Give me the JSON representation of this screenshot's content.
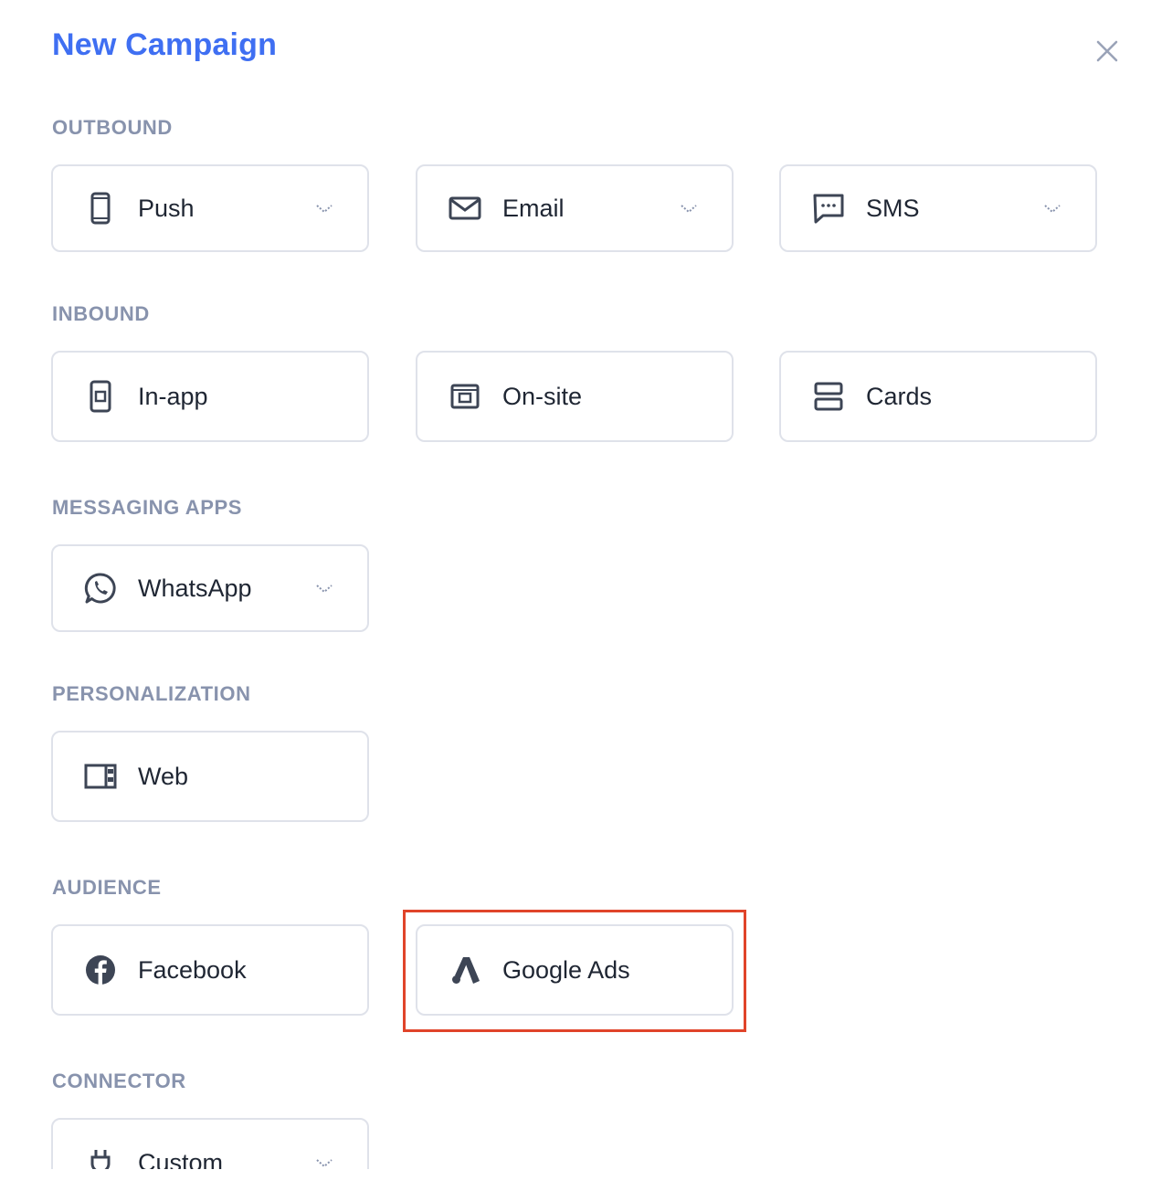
{
  "header": {
    "title": "New Campaign"
  },
  "sections": {
    "outbound": {
      "label": "OUTBOUND",
      "items": [
        {
          "label": "Push",
          "icon": "phone-icon"
        },
        {
          "label": "Email",
          "icon": "envelope-icon"
        },
        {
          "label": "SMS",
          "icon": "chat-bubble-icon"
        }
      ]
    },
    "inbound": {
      "label": "INBOUND",
      "items": [
        {
          "label": "In-app",
          "icon": "in-app-icon"
        },
        {
          "label": "On-site",
          "icon": "browser-window-icon"
        },
        {
          "label": "Cards",
          "icon": "cards-icon"
        }
      ]
    },
    "messaging_apps": {
      "label": "MESSAGING APPS",
      "items": [
        {
          "label": "WhatsApp",
          "icon": "whatsapp-icon"
        }
      ]
    },
    "personalization": {
      "label": "PERSONALIZATION",
      "items": [
        {
          "label": "Web",
          "icon": "web-layout-icon"
        }
      ]
    },
    "audience": {
      "label": "AUDIENCE",
      "items": [
        {
          "label": "Facebook",
          "icon": "facebook-icon"
        },
        {
          "label": "Google Ads",
          "icon": "google-ads-icon"
        }
      ]
    },
    "connector": {
      "label": "CONNECTOR",
      "items": [
        {
          "label": "Custom",
          "icon": "plug-icon"
        }
      ]
    }
  },
  "colors": {
    "title": "#3f6ff2",
    "section_label": "#8893ad",
    "card_border": "#dfe2ea",
    "icon": "#3d4555",
    "highlight": "#e0442a"
  }
}
